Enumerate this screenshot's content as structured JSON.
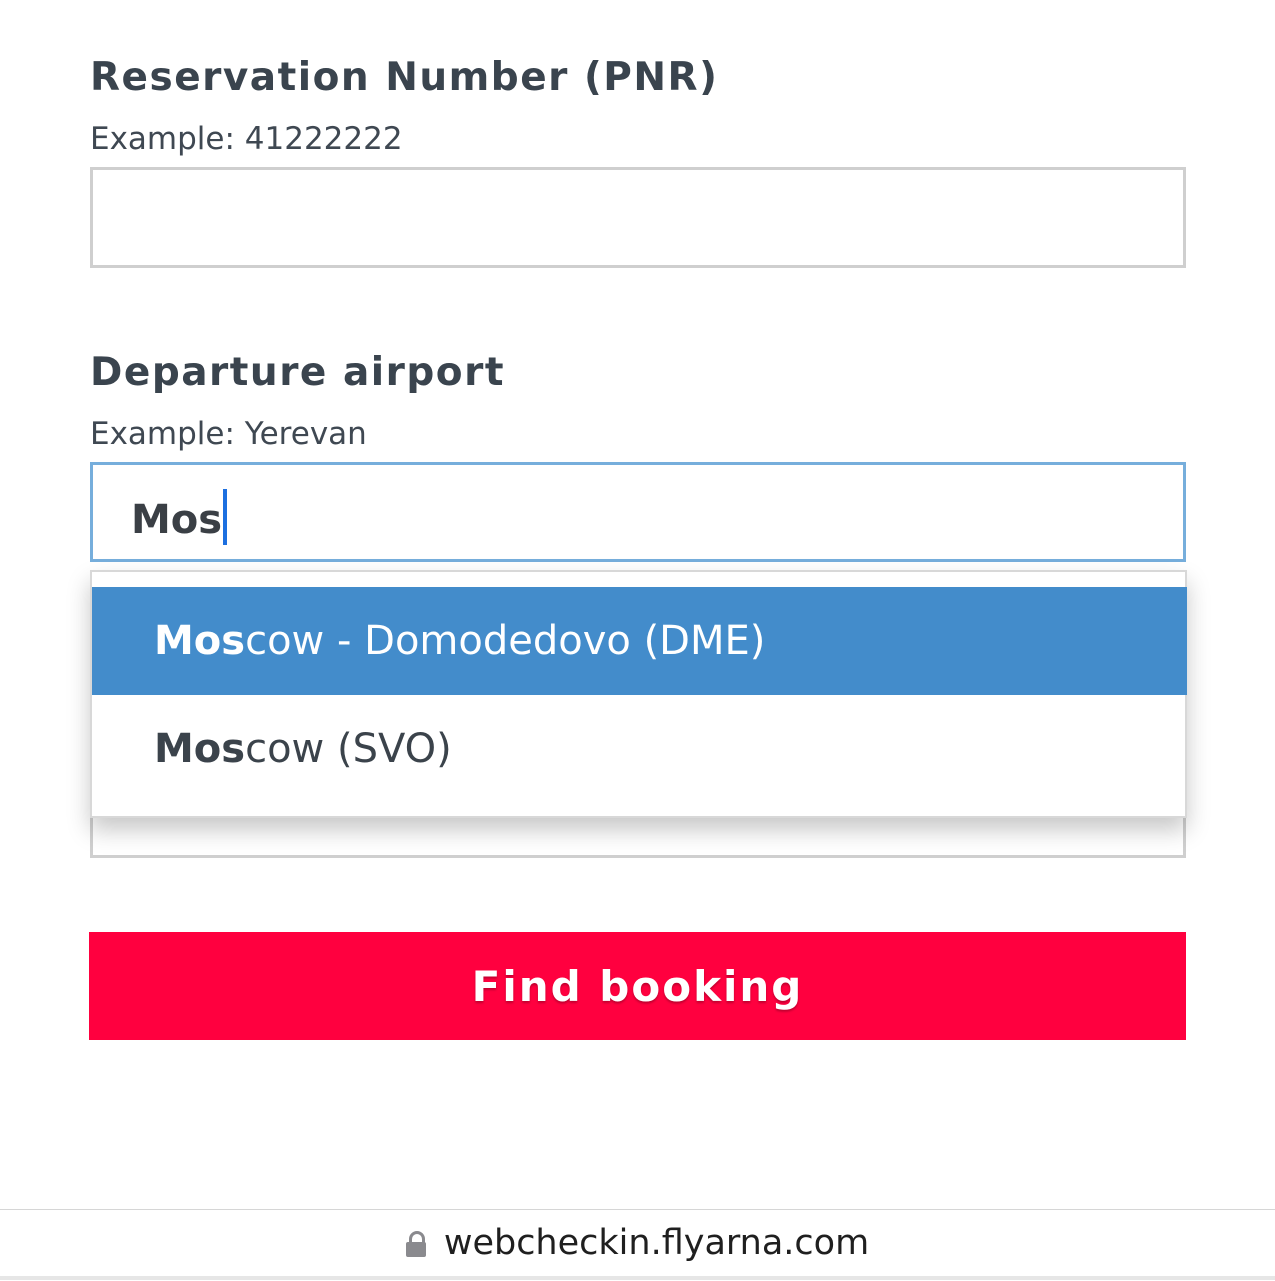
{
  "form": {
    "pnr": {
      "label": "Reservation Number (PNR)",
      "example": "Example: 41222222",
      "value": ""
    },
    "departure": {
      "label": "Departure airport",
      "example": "Example: Yerevan",
      "value": "Mos"
    },
    "suggestions": [
      {
        "match": "Mos",
        "rest": "cow - Domodedovo (DME)",
        "highlighted": true
      },
      {
        "match": "Mos",
        "rest": "cow (SVO)",
        "highlighted": false
      }
    ],
    "submit_label": "Find booking"
  },
  "browser": {
    "url": "webcheckin.flyarna.com"
  },
  "colors": {
    "button": "#ff003f",
    "highlight": "#438ccb",
    "focus_border": "#76aedc",
    "text": "#3a444e"
  }
}
